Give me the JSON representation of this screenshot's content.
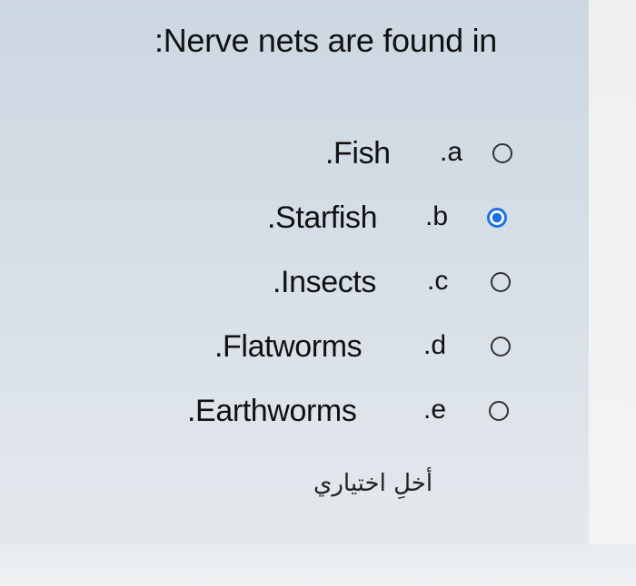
{
  "question": {
    "text": ":Nerve nets are found in"
  },
  "options": [
    {
      "label": ".Fish",
      "letter": ".a",
      "checked": false
    },
    {
      "label": ".Starfish",
      "letter": ".b",
      "checked": true
    },
    {
      "label": ".Insects",
      "letter": ".c",
      "checked": false
    },
    {
      "label": ".Flatworms",
      "letter": ".d",
      "checked": false
    },
    {
      "label": ".Earthworms",
      "letter": ".e",
      "checked": false
    }
  ],
  "clear_choice": {
    "label": "أخلِ اختياري"
  },
  "colors": {
    "selected_radio": "#1a73e8"
  }
}
